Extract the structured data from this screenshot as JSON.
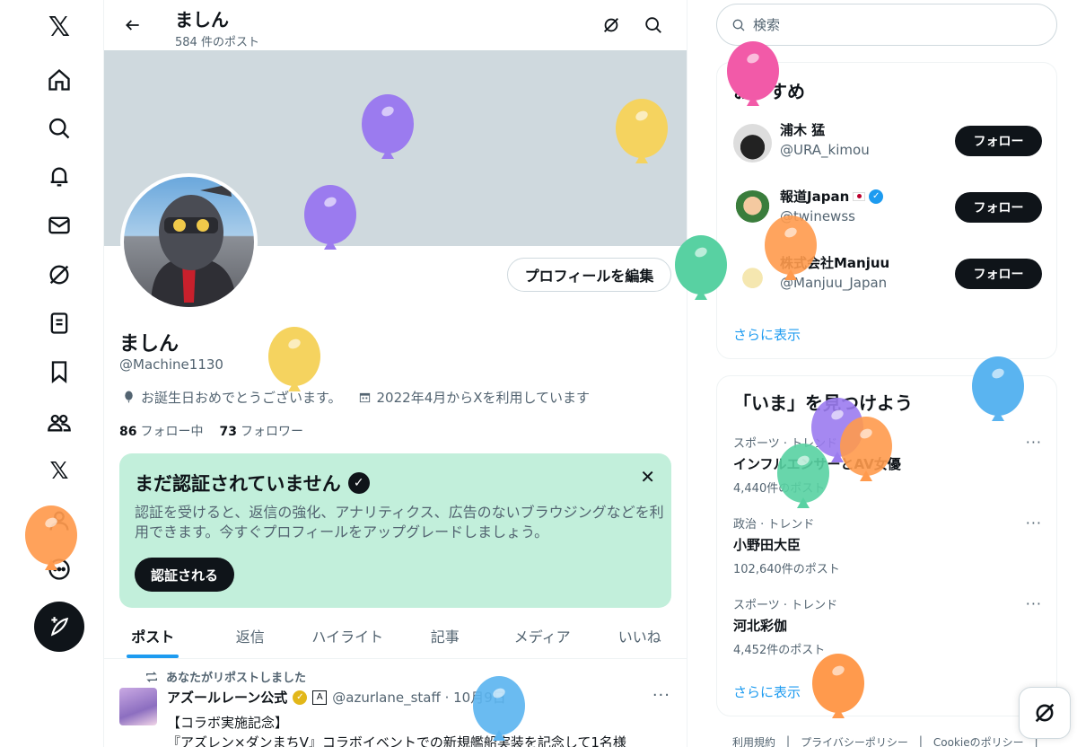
{
  "nav": {
    "logo": "𝕏",
    "items": [
      "home-icon",
      "search-icon",
      "bell-icon",
      "mail-icon",
      "grok-icon",
      "list-icon",
      "bookmark-icon",
      "people-icon",
      "x-premium-icon",
      "profile-icon",
      "more-icon"
    ],
    "x_premium": "𝕏",
    "more": "⋯",
    "compose": "compose-icon"
  },
  "header": {
    "name": "ましん",
    "post_count": "584 件のポスト"
  },
  "profile": {
    "name": "ましん",
    "handle": "@Machine1130",
    "birthday": "お誕生日おめでとうございます。",
    "joined": "2022年4月からXを利用しています",
    "following_count": "86",
    "following_label": "フォロー中",
    "followers_count": "73",
    "followers_label": "フォロワー",
    "edit_button": "プロフィールを編集"
  },
  "verify": {
    "title": "まだ認証されていません",
    "badge": "✓",
    "close": "✕",
    "text": "認証を受けると、返信の強化、アナリティクス、広告のないブラウジングなどを利用できます。今すぐプロフィールをアップグレードしましょう。",
    "button": "認証される"
  },
  "tabs": [
    "ポスト",
    "返信",
    "ハイライト",
    "記事",
    "メディア",
    "いいね"
  ],
  "post": {
    "repost_note": "あなたがリポストしました",
    "author": "アズールレーン公式",
    "gold_badge": "✓",
    "affiliate": "A",
    "handle_time": "@azurlane_staff · 10月9日",
    "more": "···",
    "line1": "【コラボ実施記念】",
    "line2": "『アズレン×ダンまちⅤ』コラボイベントでの新規艦船実装を記念して1名様"
  },
  "right": {
    "search_placeholder": "検索",
    "recommend_title": "おすすめ",
    "recommend": [
      {
        "name": "浦木 猛",
        "handle": "@URA_kimou",
        "button": "フォロー"
      },
      {
        "name": "報道Japan",
        "handle": "@twinewss",
        "button": "フォロー",
        "verified": "✓"
      },
      {
        "name": "株式会社Manjuu",
        "handle": "@Manjuu_Japan",
        "button": "フォロー"
      }
    ],
    "recommend_more": "さらに表示",
    "trends_title": "「いま」を見つけよう",
    "trends": [
      {
        "category": "スポーツ · トレンド",
        "title": "インフルエンサーとAV女優",
        "count": "4,440件のポスト",
        "more": "···"
      },
      {
        "category": "政治 · トレンド",
        "title": "小野田大臣",
        "count": "102,640件のポスト",
        "more": "···"
      },
      {
        "category": "スポーツ · トレンド",
        "title": "河北彩伽",
        "count": "4,452件のポスト",
        "more": "···"
      }
    ],
    "trends_more": "さらに表示",
    "footer": [
      "利用規約",
      "|",
      "プライバシーポリシー",
      "|",
      "Cookieのポリシー",
      "|"
    ]
  },
  "colors": {
    "accent": "#1d9bf0",
    "verify_card": "#c2efdb",
    "banner": "#cfd9de",
    "balloons": [
      "#f25aa8",
      "#9b7bef",
      "#f5d35f",
      "#58d1a2",
      "#ff9a4d",
      "#5ab4f0"
    ]
  }
}
